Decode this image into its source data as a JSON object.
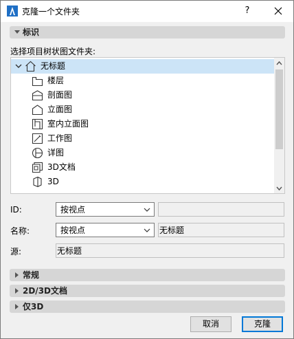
{
  "window": {
    "title": "克隆一个文件夹",
    "help_label": "?"
  },
  "sections": {
    "identify": "标识",
    "general": "常规",
    "doc_2d3d": "2D/3D文档",
    "only3d": "仅3D"
  },
  "tree": {
    "caption": "选择项目树状图文件夹:",
    "root": {
      "label": "无标题",
      "icon": "home-icon"
    },
    "items": [
      {
        "label": "楼层",
        "icon": "story-icon"
      },
      {
        "label": "剖面图",
        "icon": "section-icon"
      },
      {
        "label": "立面图",
        "icon": "elevation-icon"
      },
      {
        "label": "室内立面图",
        "icon": "interior-elevation-icon"
      },
      {
        "label": "工作图",
        "icon": "worksheet-icon"
      },
      {
        "label": "详图",
        "icon": "detail-icon"
      },
      {
        "label": "3D文档",
        "icon": "3d-document-icon"
      },
      {
        "label": "3D",
        "icon": "3d-icon"
      }
    ]
  },
  "form": {
    "id_label": "ID:",
    "id_select": "按视点",
    "id_value": "",
    "name_label": "名称:",
    "name_select": "按视点",
    "name_value": "无标题",
    "source_label": "源:",
    "source_value": "无标题"
  },
  "buttons": {
    "cancel": "取消",
    "clone": "克隆"
  },
  "colors": {
    "selection": "#cce4f7",
    "primary_border": "#0078d7",
    "section_bar": "#d6d6d6"
  }
}
